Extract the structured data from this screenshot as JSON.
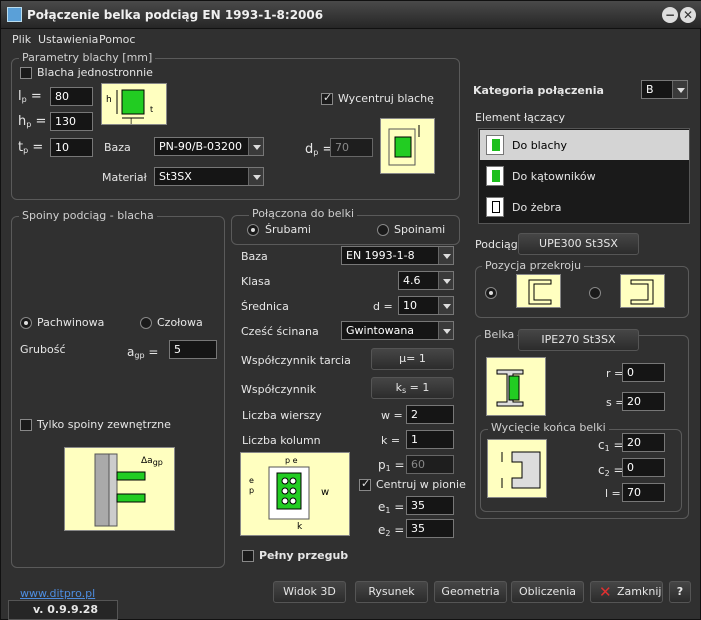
{
  "window": {
    "title": "Połączenie belka podciąg  EN 1993-1-8:2006"
  },
  "menu": [
    "Plik",
    "Ustawienia",
    "Pomoc"
  ],
  "plate": {
    "title": "Parametry blachy [mm]",
    "single_label": "Blacha jednostronnie",
    "lp_label": "l",
    "lp_sub": "p",
    "lp": "80",
    "hp_label": "h",
    "hp_sub": "p",
    "hp": "130",
    "tp_label": "t",
    "tp_sub": "p",
    "tp": "10",
    "base_label": "Baza",
    "base": "PN-90/B-03200",
    "material_label": "Materiał",
    "material": "St3SX",
    "center_label": "Wycentruj blachę",
    "dp_label": "d",
    "dp_sub": "p",
    "dp": "70"
  },
  "welds": {
    "title": "Spoiny podciąg - blacha",
    "fillet": "Pachwinowa",
    "butt": "Czołowa",
    "thick_label": "Grubość",
    "agp_label": "a",
    "agp_sub": "gp",
    "agp": "5",
    "outer_only": "Tylko spoiny zewnętrzne",
    "fig_label": "a",
    "fig_sub": "gp"
  },
  "bolts": {
    "title": "Połączona do belki",
    "r_bolts": "Śrubami",
    "r_welds": "Spoinami",
    "base_label": "Baza",
    "base": "EN 1993-1-8",
    "class_label": "Klasa",
    "class": "4.6",
    "dia_label": "Średnica",
    "d_label": "d =",
    "d": "10",
    "shear_label": "Cześć ścinana",
    "shear": "Gwintowana",
    "friction_label": "Współczynnik tarcia",
    "mu": "μ= 1",
    "coef_label": "Współczynnik",
    "ks": "k",
    "ks_sub": "s",
    "ks_tail": "= 1",
    "rows_label": "Liczba wierszy",
    "w_label": "w =",
    "w": "2",
    "cols_label": "Liczba kolumn",
    "k_label": "k =",
    "k": "1",
    "p1_label": "p",
    "p1_sub": "1",
    "p1": "60",
    "center_label": "Centruj w pionie",
    "e1_label": "e",
    "e1_sub": "1",
    "e1": "35",
    "e2_label": "e",
    "e2_sub": "2",
    "e2": "35",
    "full_label": "Pełny przegub"
  },
  "category": {
    "label": "Kategoria połączenia",
    "value": "B"
  },
  "element": {
    "label": "Element łączący",
    "items": [
      "Do blachy",
      "Do kątowników",
      "Do żebra"
    ]
  },
  "girder": {
    "label": "Podciąg",
    "value": "UPE300  St3SX",
    "pos_title": "Pozycja przekroju"
  },
  "beam": {
    "title": "Belka",
    "value": "IPE270 St3SX",
    "r_label": "r =",
    "r": "0",
    "s_label": "s =",
    "s": "20",
    "cut_title": "Wycięcie końca belki",
    "c1_label": "c",
    "c1_sub": "1",
    "c1": "20",
    "c2_label": "c",
    "c2_sub": "2",
    "c2": "0",
    "l_label": "l =",
    "l": "70"
  },
  "footer": {
    "link": "www.ditpro.pl",
    "version": "v.  0.9.9.28",
    "b3d": "Widok 3D",
    "draw": "Rysunek",
    "geom": "Geometria",
    "calc": "Obliczenia",
    "close": "Zamknij",
    "help": "?"
  }
}
